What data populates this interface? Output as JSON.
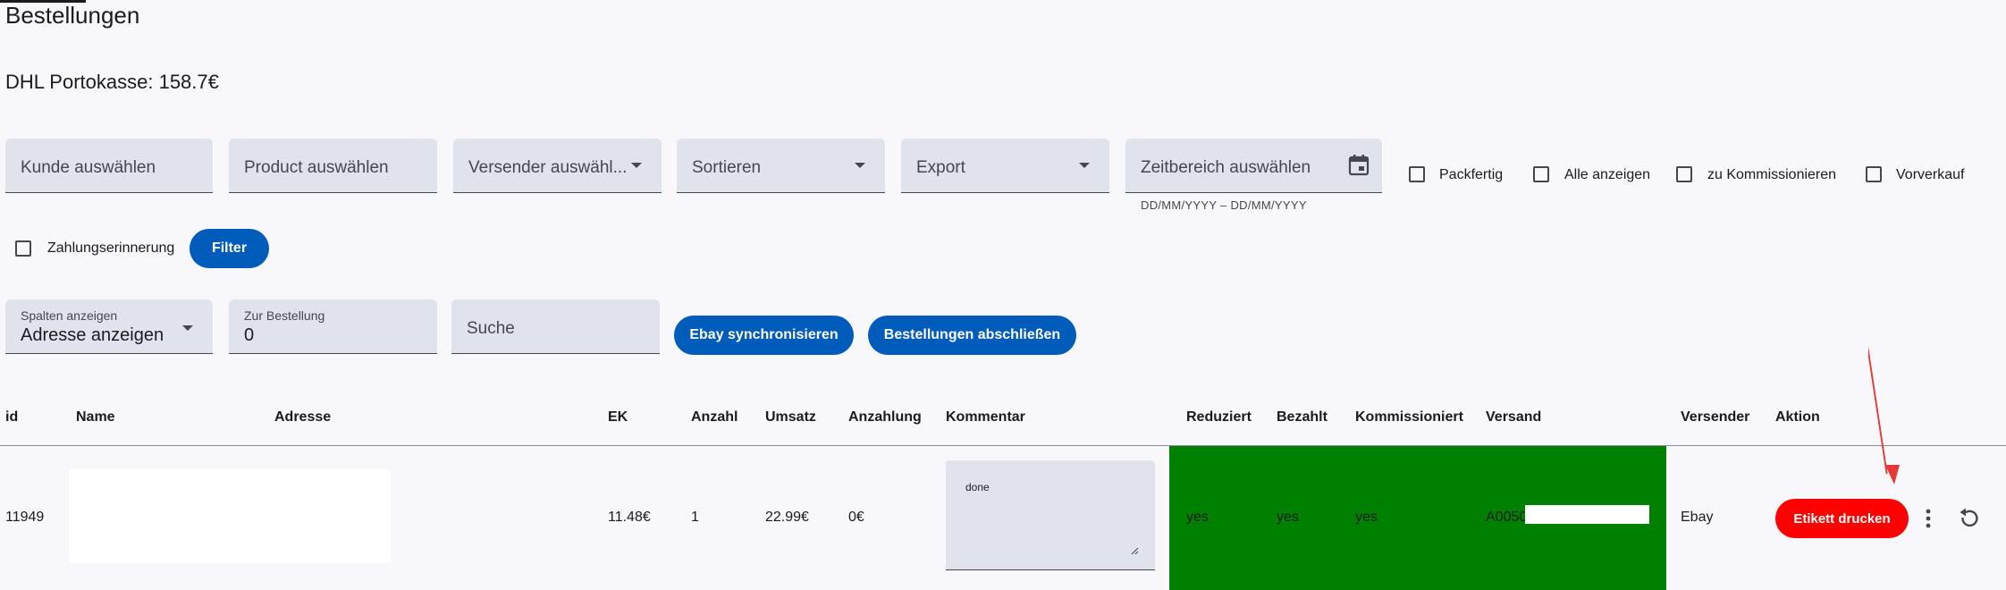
{
  "header": {
    "title": "Bestellungen",
    "porto_label": "DHL Portokasse: 158.7€"
  },
  "filters": {
    "kunde_placeholder": "Kunde auswählen",
    "product_placeholder": "Product auswählen",
    "versender_placeholder": "Versender auswähl...",
    "sortieren_placeholder": "Sortieren",
    "export_placeholder": "Export",
    "zeitbereich_placeholder": "Zeitbereich auswählen",
    "zeitbereich_hint": "DD/MM/YYYY – DD/MM/YYYY",
    "checkboxes": [
      {
        "label": "Packfertig",
        "checked": false
      },
      {
        "label": "Alle anzeigen",
        "checked": false
      },
      {
        "label": "zu Kommissionieren",
        "checked": false
      },
      {
        "label": "Vorverkauf",
        "checked": false
      },
      {
        "label": "Zahlungserinnerung",
        "checked": false
      }
    ],
    "filter_button": "Filter"
  },
  "controls": {
    "spalten_label": "Spalten anzeigen",
    "spalten_value": "Adresse anzeigen",
    "bestellung_label": "Zur Bestellung",
    "bestellung_value": "0",
    "suche_placeholder": "Suche",
    "ebay_button": "Ebay synchronisieren",
    "abschliessen_button": "Bestellungen abschließen"
  },
  "table": {
    "columns": [
      "id",
      "Name",
      "Adresse",
      "EK",
      "Anzahl",
      "Umsatz",
      "Anzahlung",
      "Kommentar",
      "Reduziert",
      "Bezahlt",
      "Kommissioniert",
      "Versand",
      "Versender",
      "Aktion"
    ],
    "rows": [
      {
        "id": "11949",
        "ek": "11.48€",
        "anzahl": "1",
        "umsatz": "22.99€",
        "anzahlung": "0€",
        "kommentar": "done",
        "reduziert": "yes",
        "bezahlt": "yes",
        "kommissioniert": "yes",
        "versand": "A0050",
        "versender": "Ebay",
        "aktion_button": "Etikett drucken"
      }
    ]
  },
  "colors": {
    "primary": "#005cbb",
    "danger": "#ff0000",
    "success": "#008000",
    "annotation_arrow": "#e53935"
  },
  "icons": [
    "calendar-icon",
    "chevron-down-icon",
    "more-vert-icon",
    "reset-icon",
    "resize-handle-icon",
    "annotation-arrow-icon"
  ]
}
